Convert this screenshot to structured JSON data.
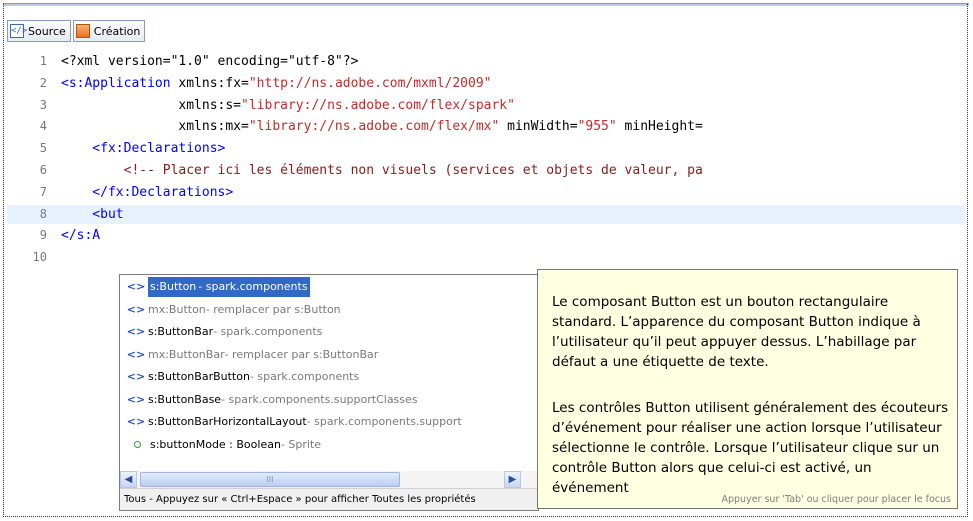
{
  "tabs": [
    {
      "label": "Source",
      "icon": "source-code-icon"
    },
    {
      "label": "Création",
      "icon": "design-view-icon"
    }
  ],
  "editor": {
    "lines": [
      {
        "num": "1",
        "parts": [
          {
            "c": "pi",
            "t": "<?xml version=\"1.0\" encoding=\"utf-8\"?>"
          }
        ]
      },
      {
        "num": "2",
        "parts": [
          {
            "c": "tag",
            "t": "<s:Application"
          },
          {
            "c": "attr",
            "t": " xmlns:fx="
          },
          {
            "c": "val",
            "t": "\"http://ns.adobe.com/mxml/2009\""
          }
        ]
      },
      {
        "num": "3",
        "parts": [
          {
            "c": "attr",
            "t": "               xmlns:s="
          },
          {
            "c": "val",
            "t": "\"library://ns.adobe.com/flex/spark\""
          }
        ]
      },
      {
        "num": "4",
        "parts": [
          {
            "c": "attr",
            "t": "               xmlns:mx="
          },
          {
            "c": "val",
            "t": "\"library://ns.adobe.com/flex/mx\""
          },
          {
            "c": "attr",
            "t": " minWidth="
          },
          {
            "c": "val",
            "t": "\"955\""
          },
          {
            "c": "attr",
            "t": " minHeight="
          }
        ]
      },
      {
        "num": "5",
        "parts": [
          {
            "c": "tag",
            "t": "    <fx:Declarations>"
          }
        ]
      },
      {
        "num": "6",
        "parts": [
          {
            "c": "cmt",
            "t": "        <!-- Placer ici les éléments non visuels (services et objets de valeur, pa"
          }
        ]
      },
      {
        "num": "7",
        "parts": [
          {
            "c": "tag",
            "t": "    </fx:Declarations>"
          }
        ]
      },
      {
        "num": "8",
        "parts": [
          {
            "c": "tag",
            "t": "    <but"
          }
        ]
      },
      {
        "num": "9",
        "parts": [
          {
            "c": "tag",
            "t": "</s:A"
          }
        ]
      },
      {
        "num": "10",
        "parts": []
      }
    ],
    "current_line": 8
  },
  "autocomplete": {
    "items": [
      {
        "name": "s:Button",
        "desc": " - spark.components",
        "kind": "component",
        "selected": true
      },
      {
        "name": "mx:Button",
        "desc": " - remplacer par s:Button",
        "kind": "component",
        "deprecated": true
      },
      {
        "name": "s:ButtonBar",
        "desc": " - spark.components",
        "kind": "component"
      },
      {
        "name": "mx:ButtonBar",
        "desc": " - remplacer par s:ButtonBar",
        "kind": "component",
        "deprecated": true
      },
      {
        "name": "s:ButtonBarButton",
        "desc": " - spark.components",
        "kind": "component"
      },
      {
        "name": "s:ButtonBase",
        "desc": " - spark.components.supportClasses",
        "kind": "component"
      },
      {
        "name": "s:ButtonBarHorizontalLayout",
        "desc": " - spark.components.support",
        "kind": "component"
      },
      {
        "name": "s:buttonMode : Boolean",
        "desc": " - Sprite",
        "kind": "property"
      }
    ],
    "footer": "Tous - Appuyez sur « Ctrl+Espace » pour afficher Toutes les propriétés",
    "scroll_thumb": "III"
  },
  "tooltip": {
    "para1": "Le composant Button est un bouton rectangulaire standard. L’apparence du composant Button indique à l’utilisateur qu’il peut appuyer dessus. L’habillage par défaut a une étiquette de texte.",
    "para2": "Les contrôles Button utilisent généralement des écouteurs d’événement pour réaliser une action lorsque l’utilisateur sélectionne le contrôle. Lorsque l’utilisateur clique sur un contrôle Button alors que celui-ci est activé, un événement",
    "footer": "Appuyer sur 'Tab' ou cliquer pour placer le focus"
  }
}
